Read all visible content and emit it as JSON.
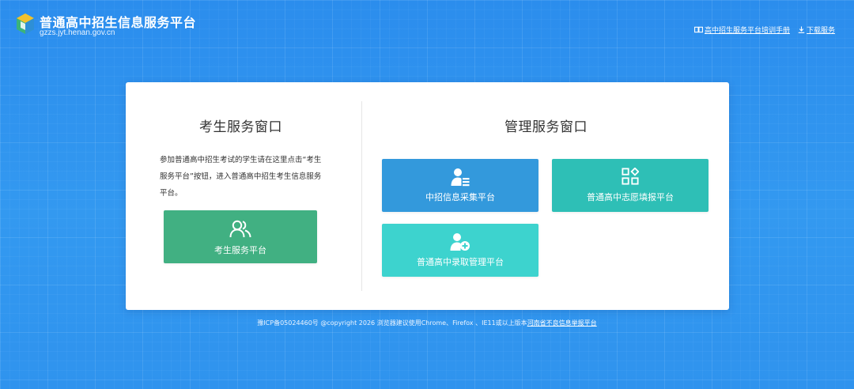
{
  "header": {
    "title": "普通高中招生信息服务平台",
    "domain": "gzzs.jyt.henan.gov.cn",
    "links": [
      {
        "label": "高中招生服务平台培训手册",
        "icon": "book-icon"
      },
      {
        "label": "下载服务",
        "icon": "download-icon"
      }
    ]
  },
  "student_panel": {
    "title": "考生服务窗口",
    "description": "参加普通高中招生考试的学生请在这里点击“考生服务平台”按钮，进入普通高中招生考生信息服务平台。",
    "button": {
      "label": "考生服务平台",
      "icon": "users-icon",
      "color": "#41b082"
    }
  },
  "admin_panel": {
    "title": "管理服务窗口",
    "tiles": [
      {
        "label": "中招信息采集平台",
        "icon": "user-list-icon",
        "color": "#3399dc"
      },
      {
        "label": "普通高中志愿填报平台",
        "icon": "apps-grid-icon",
        "color": "#2ebfb6"
      },
      {
        "label": "普通高中录取管理平台",
        "icon": "user-add-icon",
        "color": "#3dd3ce"
      }
    ]
  },
  "footer": {
    "text": "豫ICP备05024460号 @copyright 2026 浏览器建议使用Chrome、Firefox 、IE11或以上版本",
    "link": "河南省不良信息举报平台"
  },
  "colors": {
    "background": "#2f93ee",
    "card": "#ffffff"
  }
}
